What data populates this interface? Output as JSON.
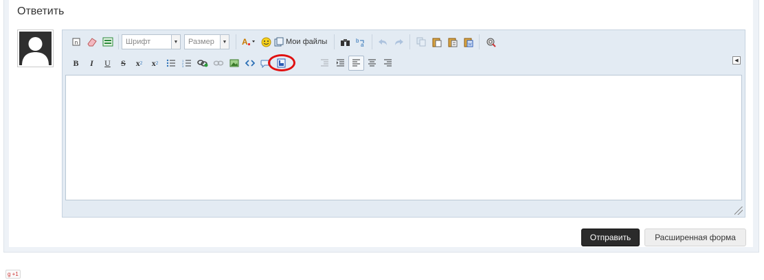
{
  "reply": {
    "title": "Ответить"
  },
  "toolbar": {
    "font_placeholder": "Шрифт",
    "size_placeholder": "Размер",
    "my_files_label": "Мои файлы",
    "bold_label": "B",
    "italic_label": "I",
    "underline_label": "U",
    "strike_label": "S",
    "subscript_label": "x",
    "superscript_label": "x",
    "sub_mark": "2",
    "sup_mark": "2"
  },
  "actions": {
    "submit_label": "Отправить",
    "extended_label": "Расширенная форма"
  },
  "social": {
    "gplus_label": "g +1"
  },
  "colors": {
    "accent_ring": "#e01010",
    "submit_bg": "#2b2b2b",
    "editor_bg": "#e3ebf3"
  }
}
